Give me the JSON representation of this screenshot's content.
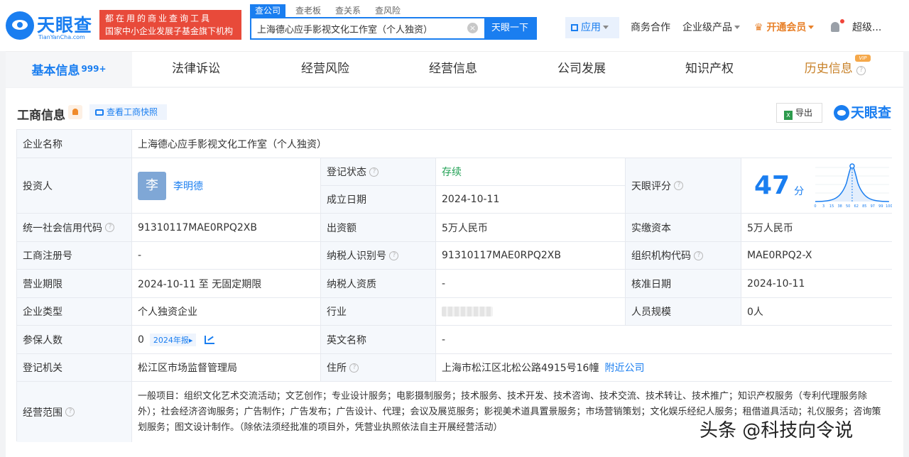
{
  "header": {
    "logo_name": "天眼查",
    "logo_sub": "TianYanCha.com",
    "slogan_line1": "都在用的商业查询工具",
    "slogan_line2": "国家中小企业发展子基金旗下机构",
    "search_tabs": [
      "查公司",
      "查老板",
      "查关系",
      "查风险"
    ],
    "search_value": "上海德心应手影视文化工作室（个人独资）",
    "search_button": "天眼一下",
    "apps_label": "应用",
    "business_coop": "商务合作",
    "enterprise_products": "企业级产品",
    "vip_label": "开通会员",
    "user_label": "超级...",
    "colors": {
      "brand": "#1a7ef0",
      "slogan_bg": "#e84a3a",
      "vip": "#e8812a"
    }
  },
  "tabs": [
    {
      "label": "基本信息",
      "badge": "999+"
    },
    {
      "label": "法律诉讼"
    },
    {
      "label": "经营风险"
    },
    {
      "label": "经营信息"
    },
    {
      "label": "公司发展"
    },
    {
      "label": "知识产权"
    },
    {
      "label": "历史信息",
      "badge": "VIP"
    }
  ],
  "section": {
    "title": "工商信息",
    "snapshot_button": "查看工商快照",
    "export_button": "导出",
    "brand": "天眼查"
  },
  "info": {
    "company_name_label": "企业名称",
    "company_name": "上海德心应手影视文化工作室（个人独资）",
    "investor_label": "投资人",
    "investor_avatar": "李",
    "investor_name": "李明德",
    "reg_status_label": "登记状态",
    "reg_status": "存续",
    "founded_label": "成立日期",
    "founded": "2024-10-11",
    "score_label": "天眼评分",
    "score": "47",
    "score_unit": "分",
    "score_axis": [
      "0",
      "3",
      "15",
      "38",
      "50",
      "62",
      "85",
      "97",
      "99",
      "100"
    ],
    "credit_code_label": "统一社会信用代码",
    "credit_code": "91310117MAE0RPQ2XB",
    "capital_label": "出资额",
    "capital": "5万人民币",
    "paid_capital_label": "实缴资本",
    "paid_capital": "5万人民币",
    "reg_no_label": "工商注册号",
    "reg_no": "-",
    "taxpayer_id_label": "纳税人识别号",
    "taxpayer_id": "91310117MAE0RPQ2XB",
    "org_code_label": "组织机构代码",
    "org_code": "MAE0RPQ2-X",
    "term_label": "营业期限",
    "term": "2024-10-11 至 无固定期限",
    "taxpayer_qual_label": "纳税人资质",
    "taxpayer_qual": "-",
    "approval_date_label": "核准日期",
    "approval_date": "2024-10-11",
    "type_label": "企业类型",
    "type": "个人独资企业",
    "industry_label": "行业",
    "staff_size_label": "人员规模",
    "staff_size": "0人",
    "insured_label": "参保人数",
    "insured": "0",
    "insured_report": "2024年报",
    "english_name_label": "英文名称",
    "english_name": "-",
    "authority_label": "登记机关",
    "authority": "松江区市场监督管理局",
    "address_label": "住所",
    "address": "上海市松江区北松公路4915号16幢",
    "nearby_link": "附近公司",
    "scope_label": "经营范围",
    "scope": "一般项目：组织文化艺术交流活动；文艺创作；专业设计服务；电影摄制服务；技术服务、技术开发、技术咨询、技术交流、技术转让、技术推广；知识产权服务（专利代理服务除外）；社会经济咨询服务；广告制作；广告发布；广告设计、代理；会议及展览服务；影视美术道具置景服务；市场营销策划；文化娱乐经纪人服务；租借道具活动；礼仪服务；咨询策划服务；图文设计制作。（除依法须经批准的项目外，凭营业执照依法自主开展经营活动）"
  },
  "watermark": "头条 @科技向令说"
}
